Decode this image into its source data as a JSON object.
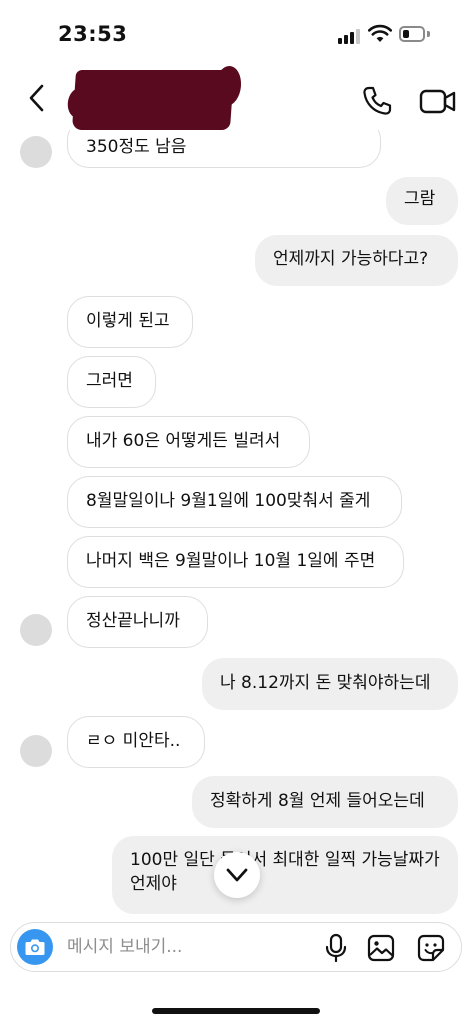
{
  "status_bar": {
    "time": "23:53",
    "battery_level": 0.35
  },
  "header": {
    "back_icon": "chevron-left-icon",
    "call_icon": "phone-icon",
    "video_icon": "video-camera-icon",
    "name_redacted": true
  },
  "messages": [
    {
      "dir": "in",
      "text": "350정도 남음"
    },
    {
      "dir": "out",
      "text": "그람"
    },
    {
      "dir": "out",
      "text": "언제까지 가능하다고?"
    },
    {
      "dir": "in",
      "text": "이렇게 된고"
    },
    {
      "dir": "in",
      "text": "그러면"
    },
    {
      "dir": "in",
      "text": "내가 60은 어떻게든 빌려서"
    },
    {
      "dir": "in",
      "text": "8월말일이나 9월1일에 100맞춰서 줄게"
    },
    {
      "dir": "in",
      "text": "나머지 백은 9월말이나 10월 1일에 주면"
    },
    {
      "dir": "in",
      "text": "정산끝나니까"
    },
    {
      "dir": "out",
      "text": "나 8.12까지 돈 맞춰야하는데"
    },
    {
      "dir": "in",
      "text": "ㄹㅇ 미안타.."
    },
    {
      "dir": "out",
      "text": "정확하게 8월 언제 들어오는데"
    },
    {
      "dir": "out",
      "text": "100만 일단 들어서 최대한 일찍 가능날짜가 언제야"
    }
  ],
  "composer": {
    "placeholder": "메시지 보내기...",
    "value": "",
    "camera_icon": "camera-icon",
    "mic_icon": "microphone-icon",
    "gallery_icon": "image-icon",
    "sticker_icon": "sticker-icon"
  },
  "scroll_down_icon": "chevron-down-icon",
  "colors": {
    "accent": "#3797f0",
    "redaction": "#5a0a1f",
    "bubble_out": "#efefef",
    "bubble_in_border": "#dedede"
  }
}
